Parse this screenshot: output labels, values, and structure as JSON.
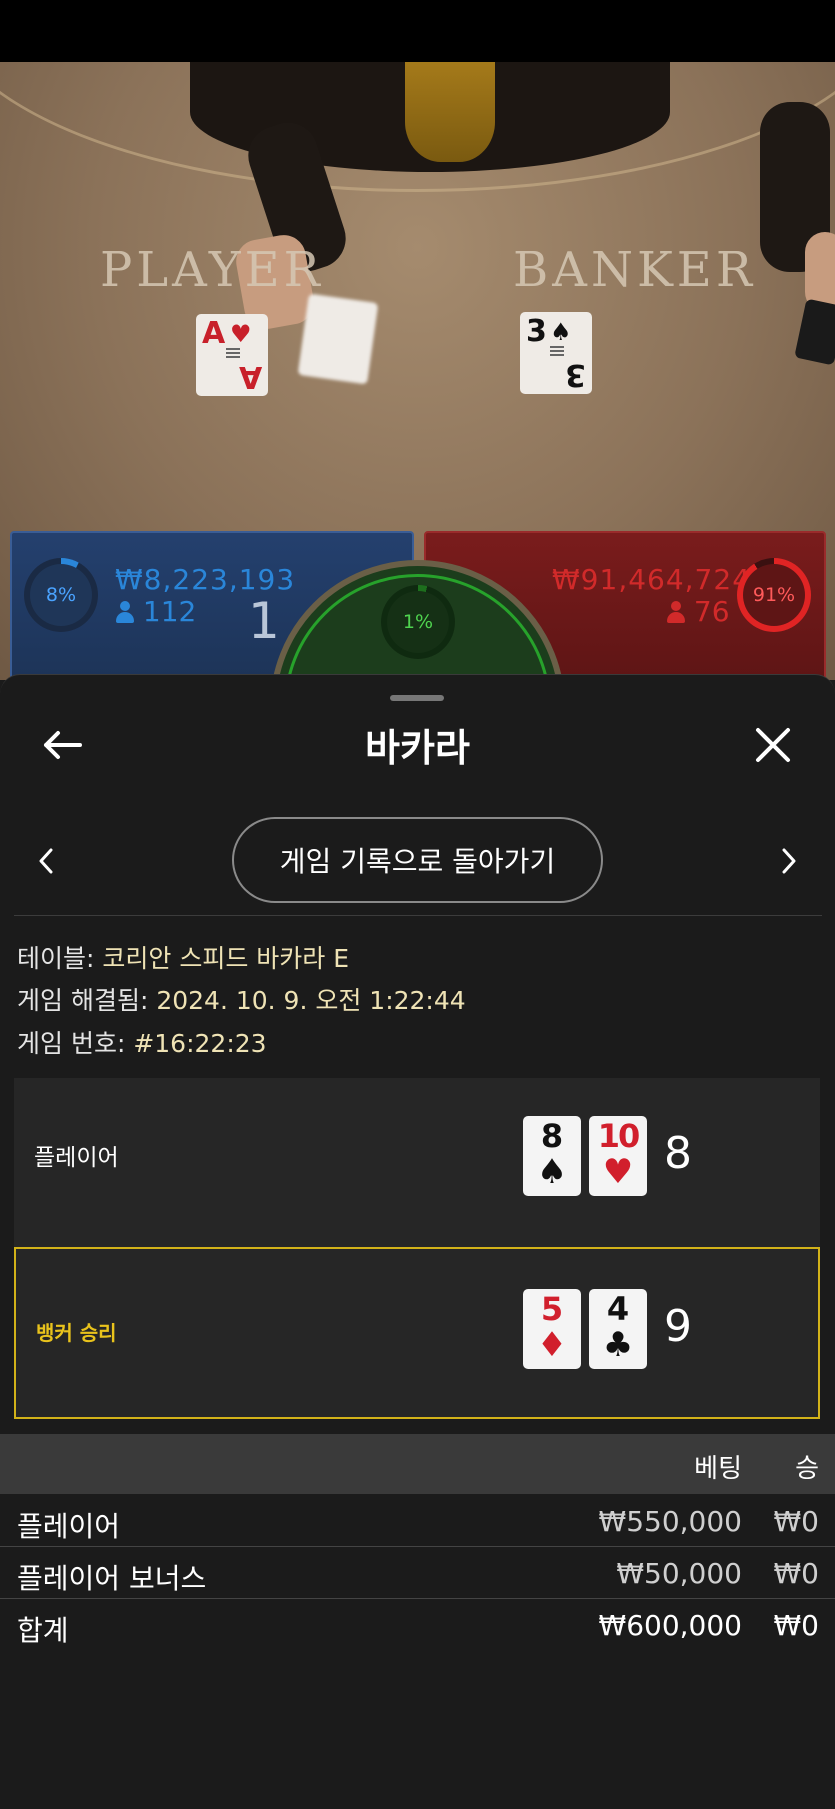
{
  "video": {
    "player_label": "PLAYER",
    "banker_label": "BANKER",
    "player_card": {
      "rank": "A",
      "suit": "♥"
    },
    "banker_card": {
      "rank": "3",
      "suit": "♠"
    }
  },
  "stats": {
    "player": {
      "percent": "8%",
      "amount": "₩8,223,193",
      "players": "112",
      "score": "1",
      "percent_value": 8,
      "color": "#2a86d9"
    },
    "tie": {
      "percent": "1%",
      "percent_value": 1,
      "color": "#27a22b"
    },
    "banker": {
      "percent": "91%",
      "amount": "₩91,464,724",
      "players": "76",
      "percent_value": 91,
      "color": "#e02424"
    }
  },
  "header": {
    "title": "바카라",
    "back_icon": "arrow-left-icon",
    "close_icon": "close-icon"
  },
  "nav": {
    "back_to_history_label": "게임 기록으로 돌아가기",
    "prev_icon": "chevron-left-icon",
    "next_icon": "chevron-right-icon"
  },
  "info": {
    "table_label": "테이블: ",
    "table_value": "코리안 스피드 바카라 E",
    "resolved_label": "게임 해결됨: ",
    "resolved_value": "2024. 10. 9. 오전 1:22:44",
    "game_no_label": "게임 번호: ",
    "game_no_value": "#16:22:23"
  },
  "hands": {
    "player": {
      "label": "플레이어",
      "cards": [
        {
          "rank": "8",
          "suit": "♠",
          "color": "black"
        },
        {
          "rank": "10",
          "suit": "♥",
          "color": "red"
        }
      ],
      "score": "8"
    },
    "banker": {
      "label": "뱅커 승리",
      "cards": [
        {
          "rank": "5",
          "suit": "♦",
          "color": "red"
        },
        {
          "rank": "4",
          "suit": "♣",
          "color": "black"
        }
      ],
      "score": "9",
      "winner": true,
      "highlight_color": "#d2b219"
    }
  },
  "bets": {
    "headers": {
      "bet": "베팅",
      "win": "승"
    },
    "rows": [
      {
        "name": "플레이어",
        "bet": "₩550,000",
        "win": "₩0"
      },
      {
        "name": "플레이어 보너스",
        "bet": "₩50,000",
        "win": "₩0"
      }
    ],
    "total": {
      "name": "합계",
      "bet": "₩600,000",
      "win": "₩0"
    }
  }
}
